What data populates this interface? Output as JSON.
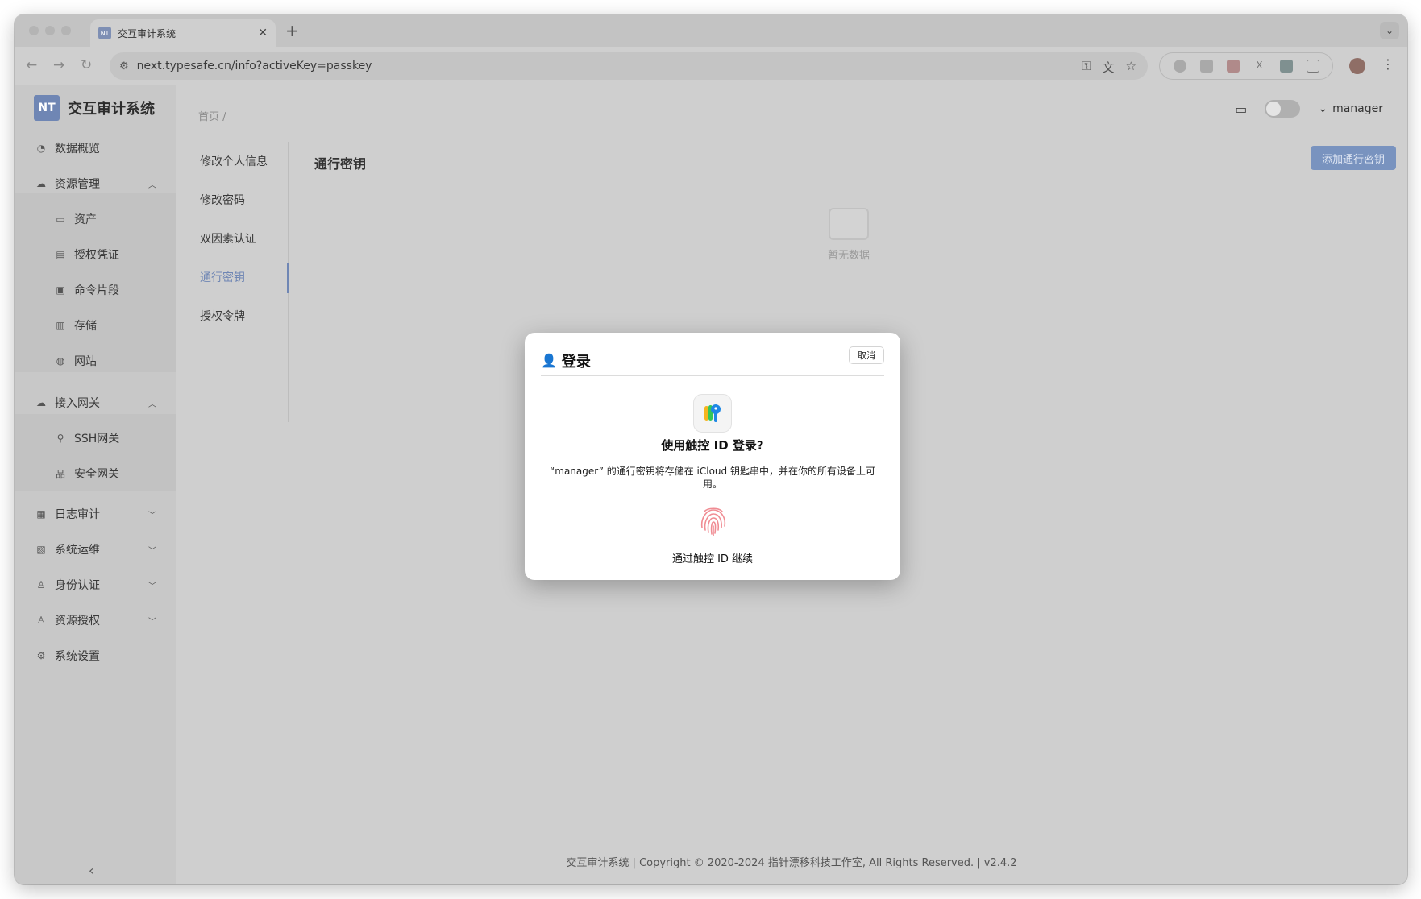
{
  "browser": {
    "tab_title": "交互审计系统",
    "favicon_text": "NT",
    "url": "next.typesafe.cn/info?activeKey=passkey"
  },
  "app": {
    "logo_text": "NT",
    "brand": "交互审计系统"
  },
  "sidebar": {
    "items": [
      {
        "label": "数据概览",
        "icon": "dashboard-icon"
      },
      {
        "label": "资源管理",
        "icon": "cloud-icon",
        "expanded": true
      },
      {
        "label": "资产",
        "icon": "monitor-icon"
      },
      {
        "label": "授权凭证",
        "icon": "credential-icon"
      },
      {
        "label": "命令片段",
        "icon": "terminal-icon"
      },
      {
        "label": "存储",
        "icon": "storage-icon"
      },
      {
        "label": "网站",
        "icon": "globe-icon"
      },
      {
        "label": "接入网关",
        "icon": "gateway-icon",
        "expanded": true
      },
      {
        "label": "SSH网关",
        "icon": "link-icon"
      },
      {
        "label": "安全网关",
        "icon": "network-icon"
      },
      {
        "label": "日志审计",
        "icon": "audit-icon"
      },
      {
        "label": "系统运维",
        "icon": "ops-icon"
      },
      {
        "label": "身份认证",
        "icon": "user-icon"
      },
      {
        "label": "资源授权",
        "icon": "user-icon"
      },
      {
        "label": "系统设置",
        "icon": "gear-icon"
      }
    ]
  },
  "header": {
    "breadcrumb": "首页 /",
    "user": "manager"
  },
  "info_tabs": {
    "items": [
      "修改个人信息",
      "修改密码",
      "双因素认证",
      "通行密钥",
      "授权令牌"
    ],
    "active_index": 3
  },
  "content": {
    "title": "通行密钥",
    "add_button": "添加通行密钥",
    "empty_text": "暂无数据"
  },
  "dialog": {
    "title": "登录",
    "cancel": "取消",
    "question": "使用触控 ID 登录?",
    "description": "“manager” 的通行密钥将存储在 iCloud 钥匙串中，并在你的所有设备上可用。",
    "continue": "通过触控 ID 继续"
  },
  "footer": "交互审计系统 | Copyright © 2020-2024 指针漂移科技工作室, All Rights Reserved. | v2.4.2",
  "colors": {
    "accent": "#6f86b4",
    "overlay": "#cfcfcf",
    "dialog_bg": "#ffffff"
  }
}
